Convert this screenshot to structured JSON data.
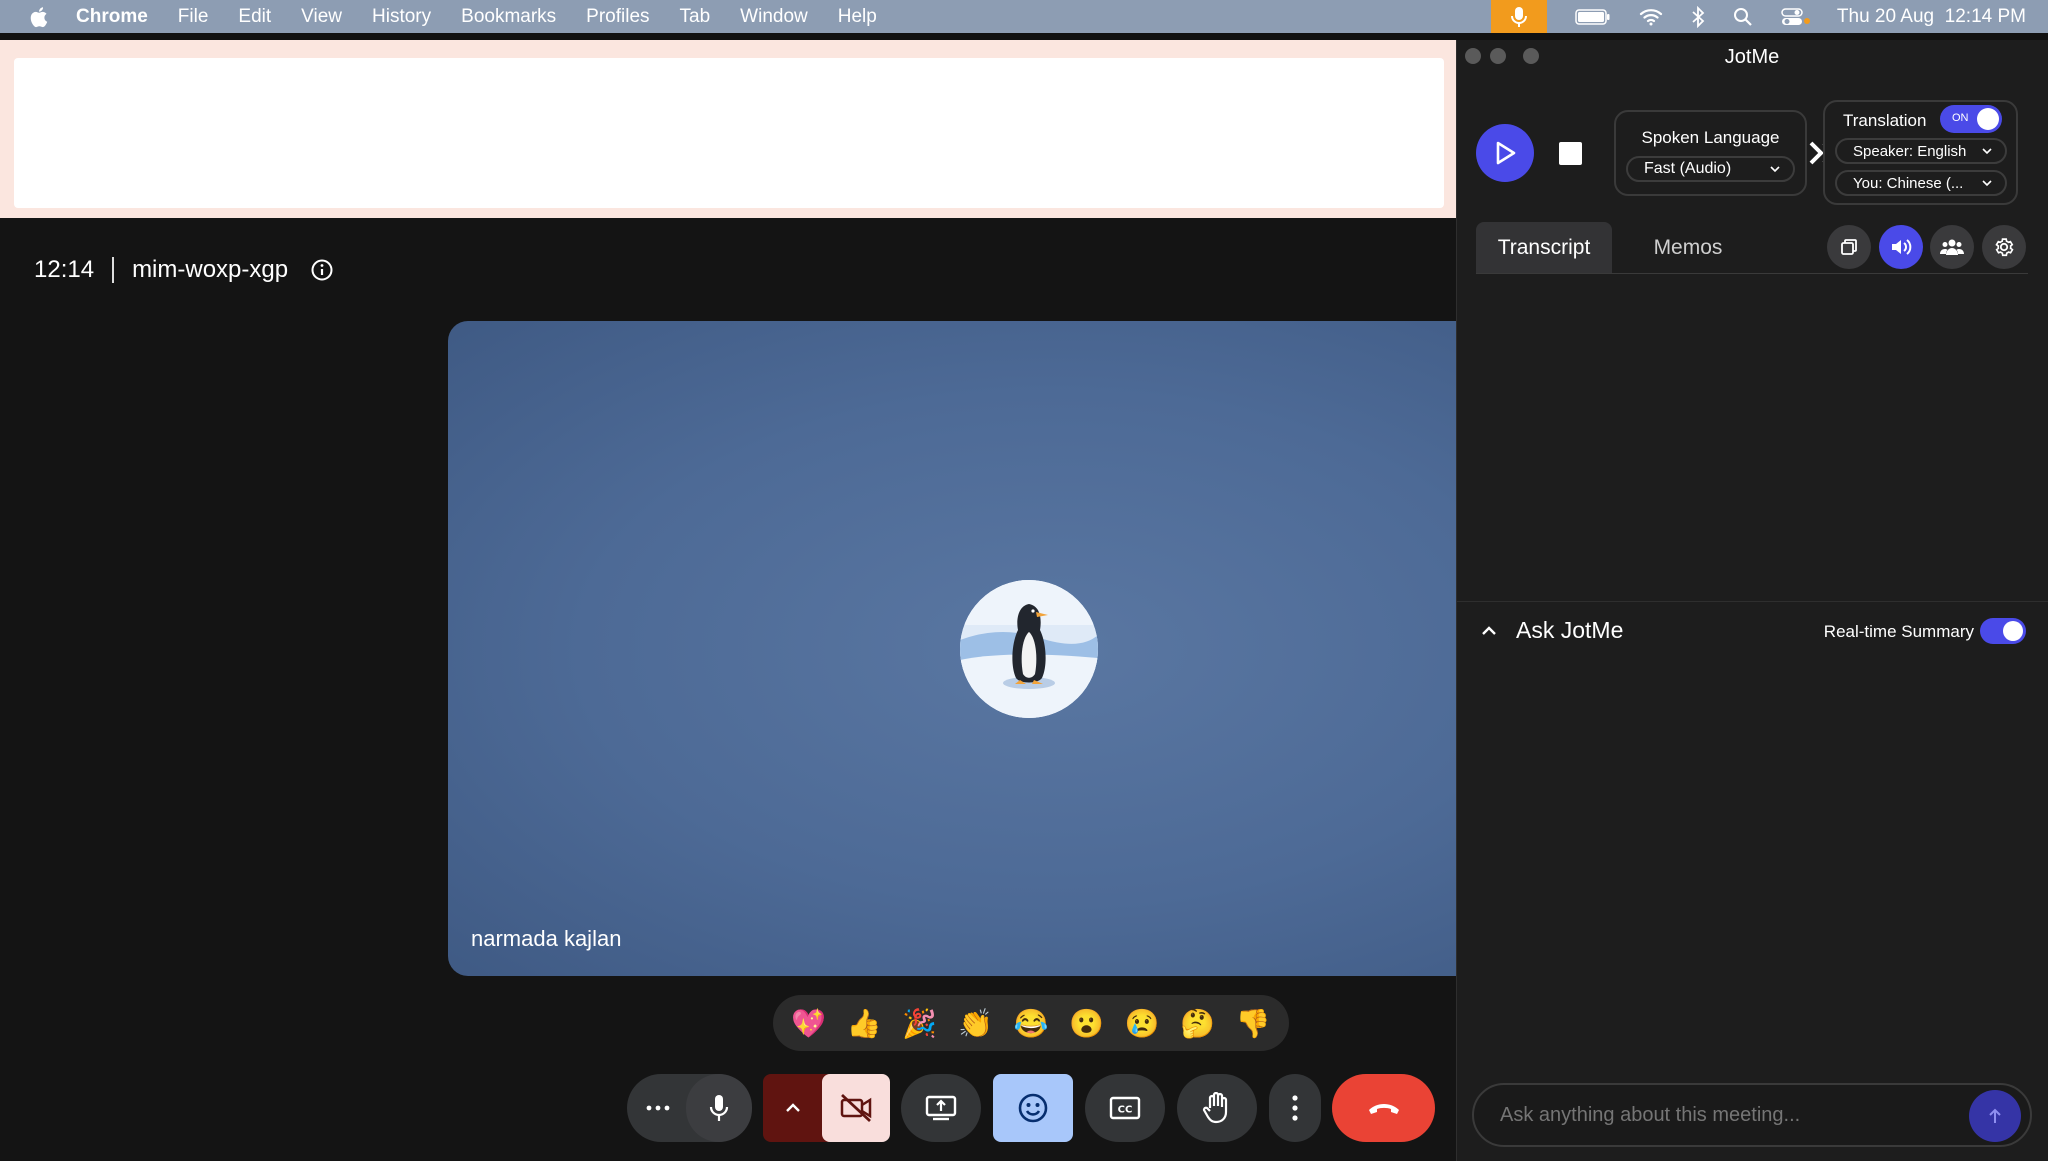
{
  "menubar": {
    "app_name": "Chrome",
    "menus": [
      "File",
      "Edit",
      "View",
      "History",
      "Bookmarks",
      "Profiles",
      "Tab",
      "Window",
      "Help"
    ],
    "date": "Thu 20 Aug",
    "time": "12:14 PM"
  },
  "meet": {
    "time": "12:14",
    "meeting_code": "mim-woxp-xgp",
    "participant_name": "narmada kajlan",
    "reactions": [
      "💖",
      "👍",
      "🎉",
      "👏",
      "😂",
      "😮",
      "😢",
      "🤔",
      "👎"
    ]
  },
  "jotme": {
    "title": "JotMe",
    "spoken_language_label": "Spoken Language",
    "spoken_language_value": "Fast (Audio)",
    "translation_label": "Translation",
    "translation_toggle": "ON",
    "speaker_language": "Speaker: English",
    "you_language": "You: Chinese (...",
    "tabs": [
      "Transcript",
      "Memos"
    ],
    "ask_title": "Ask JotMe",
    "realtime_summary_label": "Real-time Summary",
    "ask_placeholder": "Ask anything about this meeting..."
  },
  "colors": {
    "accent": "#4a4ae8",
    "end_call": "#ea4335",
    "camera_off": "#f9dedc",
    "active_reaction": "#a8c7fa"
  }
}
